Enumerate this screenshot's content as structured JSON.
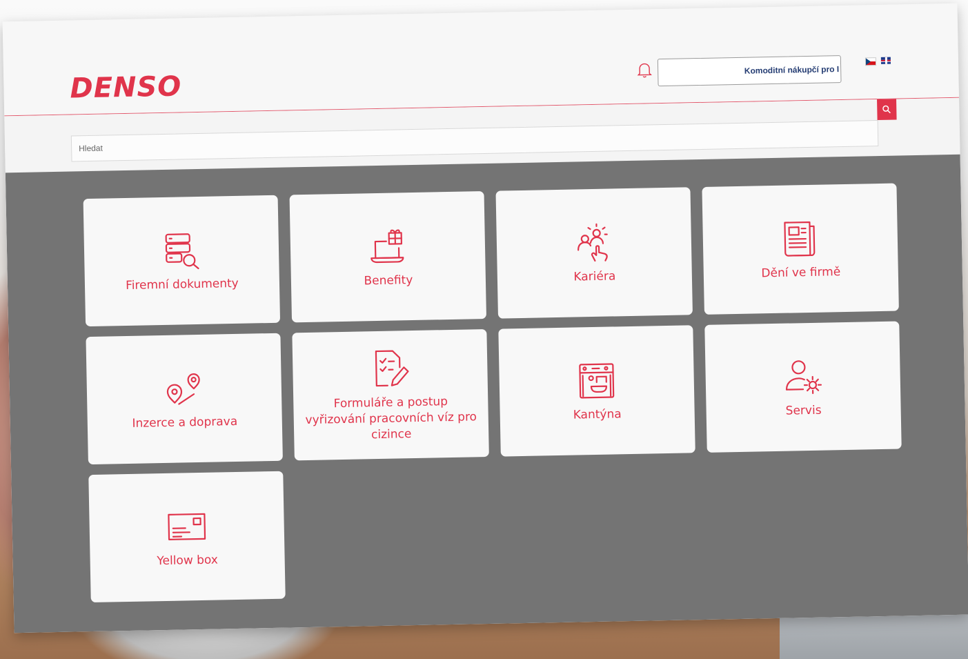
{
  "brand": {
    "logo_text": "DENSO",
    "accent_color": "#e0344b"
  },
  "header": {
    "user_label": "Komoditní nákupčí pro I",
    "languages": [
      "cs",
      "en"
    ]
  },
  "search": {
    "placeholder": "Hledat"
  },
  "tiles": [
    {
      "label": "Firemní dokumenty",
      "icon": "document-search-icon"
    },
    {
      "label": "Benefity",
      "icon": "gift-laptop-icon"
    },
    {
      "label": "Kariéra",
      "icon": "career-people-icon"
    },
    {
      "label": "Dění ve firmě",
      "icon": "newspaper-icon"
    },
    {
      "label": "Inzerce a doprava",
      "icon": "route-pins-icon"
    },
    {
      "label": "Formuláře a postup vyřizování pracovních víz pro cizince",
      "icon": "checklist-pen-icon"
    },
    {
      "label": "Kantýna",
      "icon": "coffee-machine-icon"
    },
    {
      "label": "Servis",
      "icon": "user-gear-icon"
    },
    {
      "label": "Yellow box",
      "icon": "postcard-icon"
    }
  ]
}
